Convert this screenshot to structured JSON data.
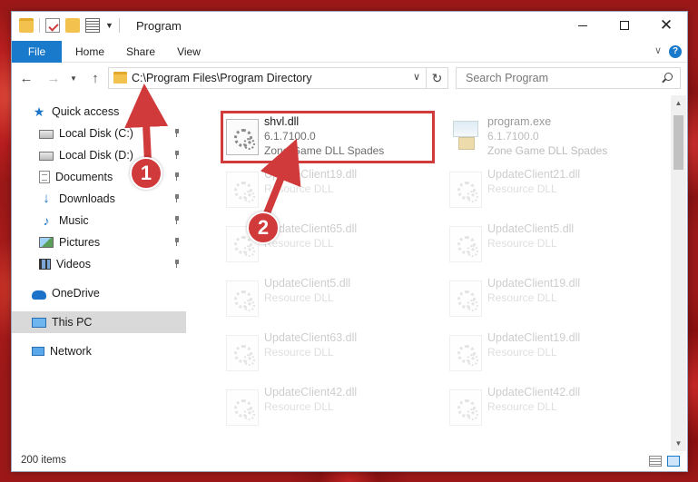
{
  "window": {
    "title": "Program",
    "colors": {
      "accent": "#1979ca",
      "annotation": "#d23b3b"
    }
  },
  "ribbon": {
    "tabs": [
      "File",
      "Home",
      "Share",
      "View"
    ],
    "expand_icon": "chevron-down-icon",
    "help_label": "?"
  },
  "nav": {
    "address": "C:\\Program Files\\Program Directory",
    "search_placeholder": "Search Program"
  },
  "sidebar": {
    "items": [
      {
        "label": "Quick access",
        "icon": "star-icon",
        "pinned": false
      },
      {
        "label": "Local Disk (C:)",
        "icon": "disk-icon",
        "pinned": true
      },
      {
        "label": "Local Disk (D:)",
        "icon": "disk-icon",
        "pinned": true
      },
      {
        "label": "Documents",
        "icon": "documents-icon",
        "pinned": true
      },
      {
        "label": "Downloads",
        "icon": "download-icon",
        "pinned": true
      },
      {
        "label": "Music",
        "icon": "music-icon",
        "pinned": true
      },
      {
        "label": "Pictures",
        "icon": "pictures-icon",
        "pinned": true
      },
      {
        "label": "Videos",
        "icon": "videos-icon",
        "pinned": true
      },
      {
        "label": "OneDrive",
        "icon": "cloud-icon",
        "pinned": false
      },
      {
        "label": "This PC",
        "icon": "computer-icon",
        "pinned": false,
        "selected": true
      },
      {
        "label": "Network",
        "icon": "network-icon",
        "pinned": false
      }
    ]
  },
  "files": [
    {
      "name": "shvl.dll",
      "line2": "6.1.7100.0",
      "line3": "Zone Game DLL  Spades",
      "highlighted": true
    },
    {
      "name": "program.exe",
      "line2": "6.1.7100.0",
      "line3": "Zone Game DLL  Spades",
      "type": "exe"
    },
    {
      "name": "UpdateClient19.dll",
      "line2": "Resource DLL"
    },
    {
      "name": "UpdateClient21.dll",
      "line2": "Resource DLL"
    },
    {
      "name": "UpdateClient65.dll",
      "line2": "Resource DLL"
    },
    {
      "name": "UpdateClient5.dll",
      "line2": "Resource DLL"
    },
    {
      "name": "UpdateClient5.dll",
      "line2": "Resource DLL"
    },
    {
      "name": "UpdateClient19.dll",
      "line2": "Resource DLL"
    },
    {
      "name": "UpdateClient63.dll",
      "line2": "Resource DLL"
    },
    {
      "name": "UpdateClient19.dll",
      "line2": "Resource DLL"
    },
    {
      "name": "UpdateClient42.dll",
      "line2": "Resource DLL"
    },
    {
      "name": "UpdateClient42.dll",
      "line2": "Resource DLL"
    }
  ],
  "status": {
    "item_count": "200 items"
  },
  "callouts": [
    "1",
    "2"
  ]
}
